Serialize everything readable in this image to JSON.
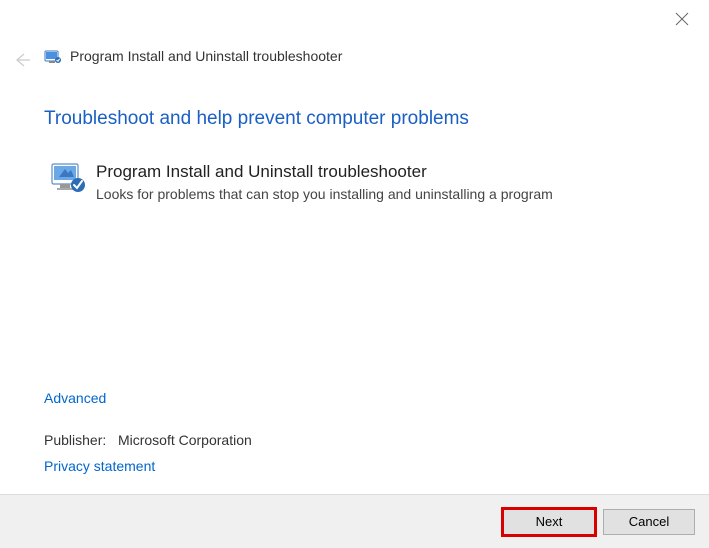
{
  "window": {
    "title": "Program Install and Uninstall troubleshooter"
  },
  "content": {
    "heading": "Troubleshoot and help prevent computer problems",
    "program_title": "Program Install and Uninstall troubleshooter",
    "program_description": "Looks for problems that can stop you installing and uninstalling a program",
    "advanced": "Advanced",
    "publisher_label": "Publisher:",
    "publisher_value": "Microsoft Corporation",
    "privacy": "Privacy statement"
  },
  "buttons": {
    "next": "Next",
    "cancel": "Cancel"
  }
}
